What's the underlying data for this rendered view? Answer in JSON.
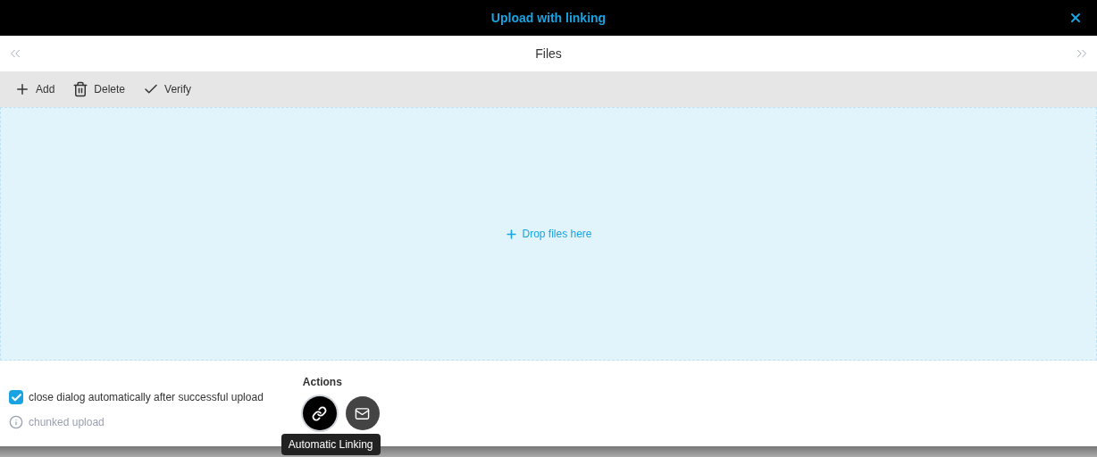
{
  "window": {
    "title": "Upload with linking"
  },
  "pager": {
    "title": "Files"
  },
  "toolbar": [
    {
      "kind": "add",
      "label": "Add"
    },
    {
      "kind": "delete",
      "label": "Delete"
    },
    {
      "kind": "verify",
      "label": "Verify"
    }
  ],
  "dropzone": {
    "label": "Drop files here"
  },
  "options": {
    "close_automatically": {
      "label": "close dialog automatically after successful upload",
      "checked": true
    },
    "chunked": {
      "label": "chunked upload"
    }
  },
  "actions": {
    "title": "Actions",
    "buttons": [
      {
        "kind": "link",
        "selected": true
      },
      {
        "kind": "mail",
        "selected": false
      }
    ],
    "tooltip": "Automatic Linking"
  }
}
